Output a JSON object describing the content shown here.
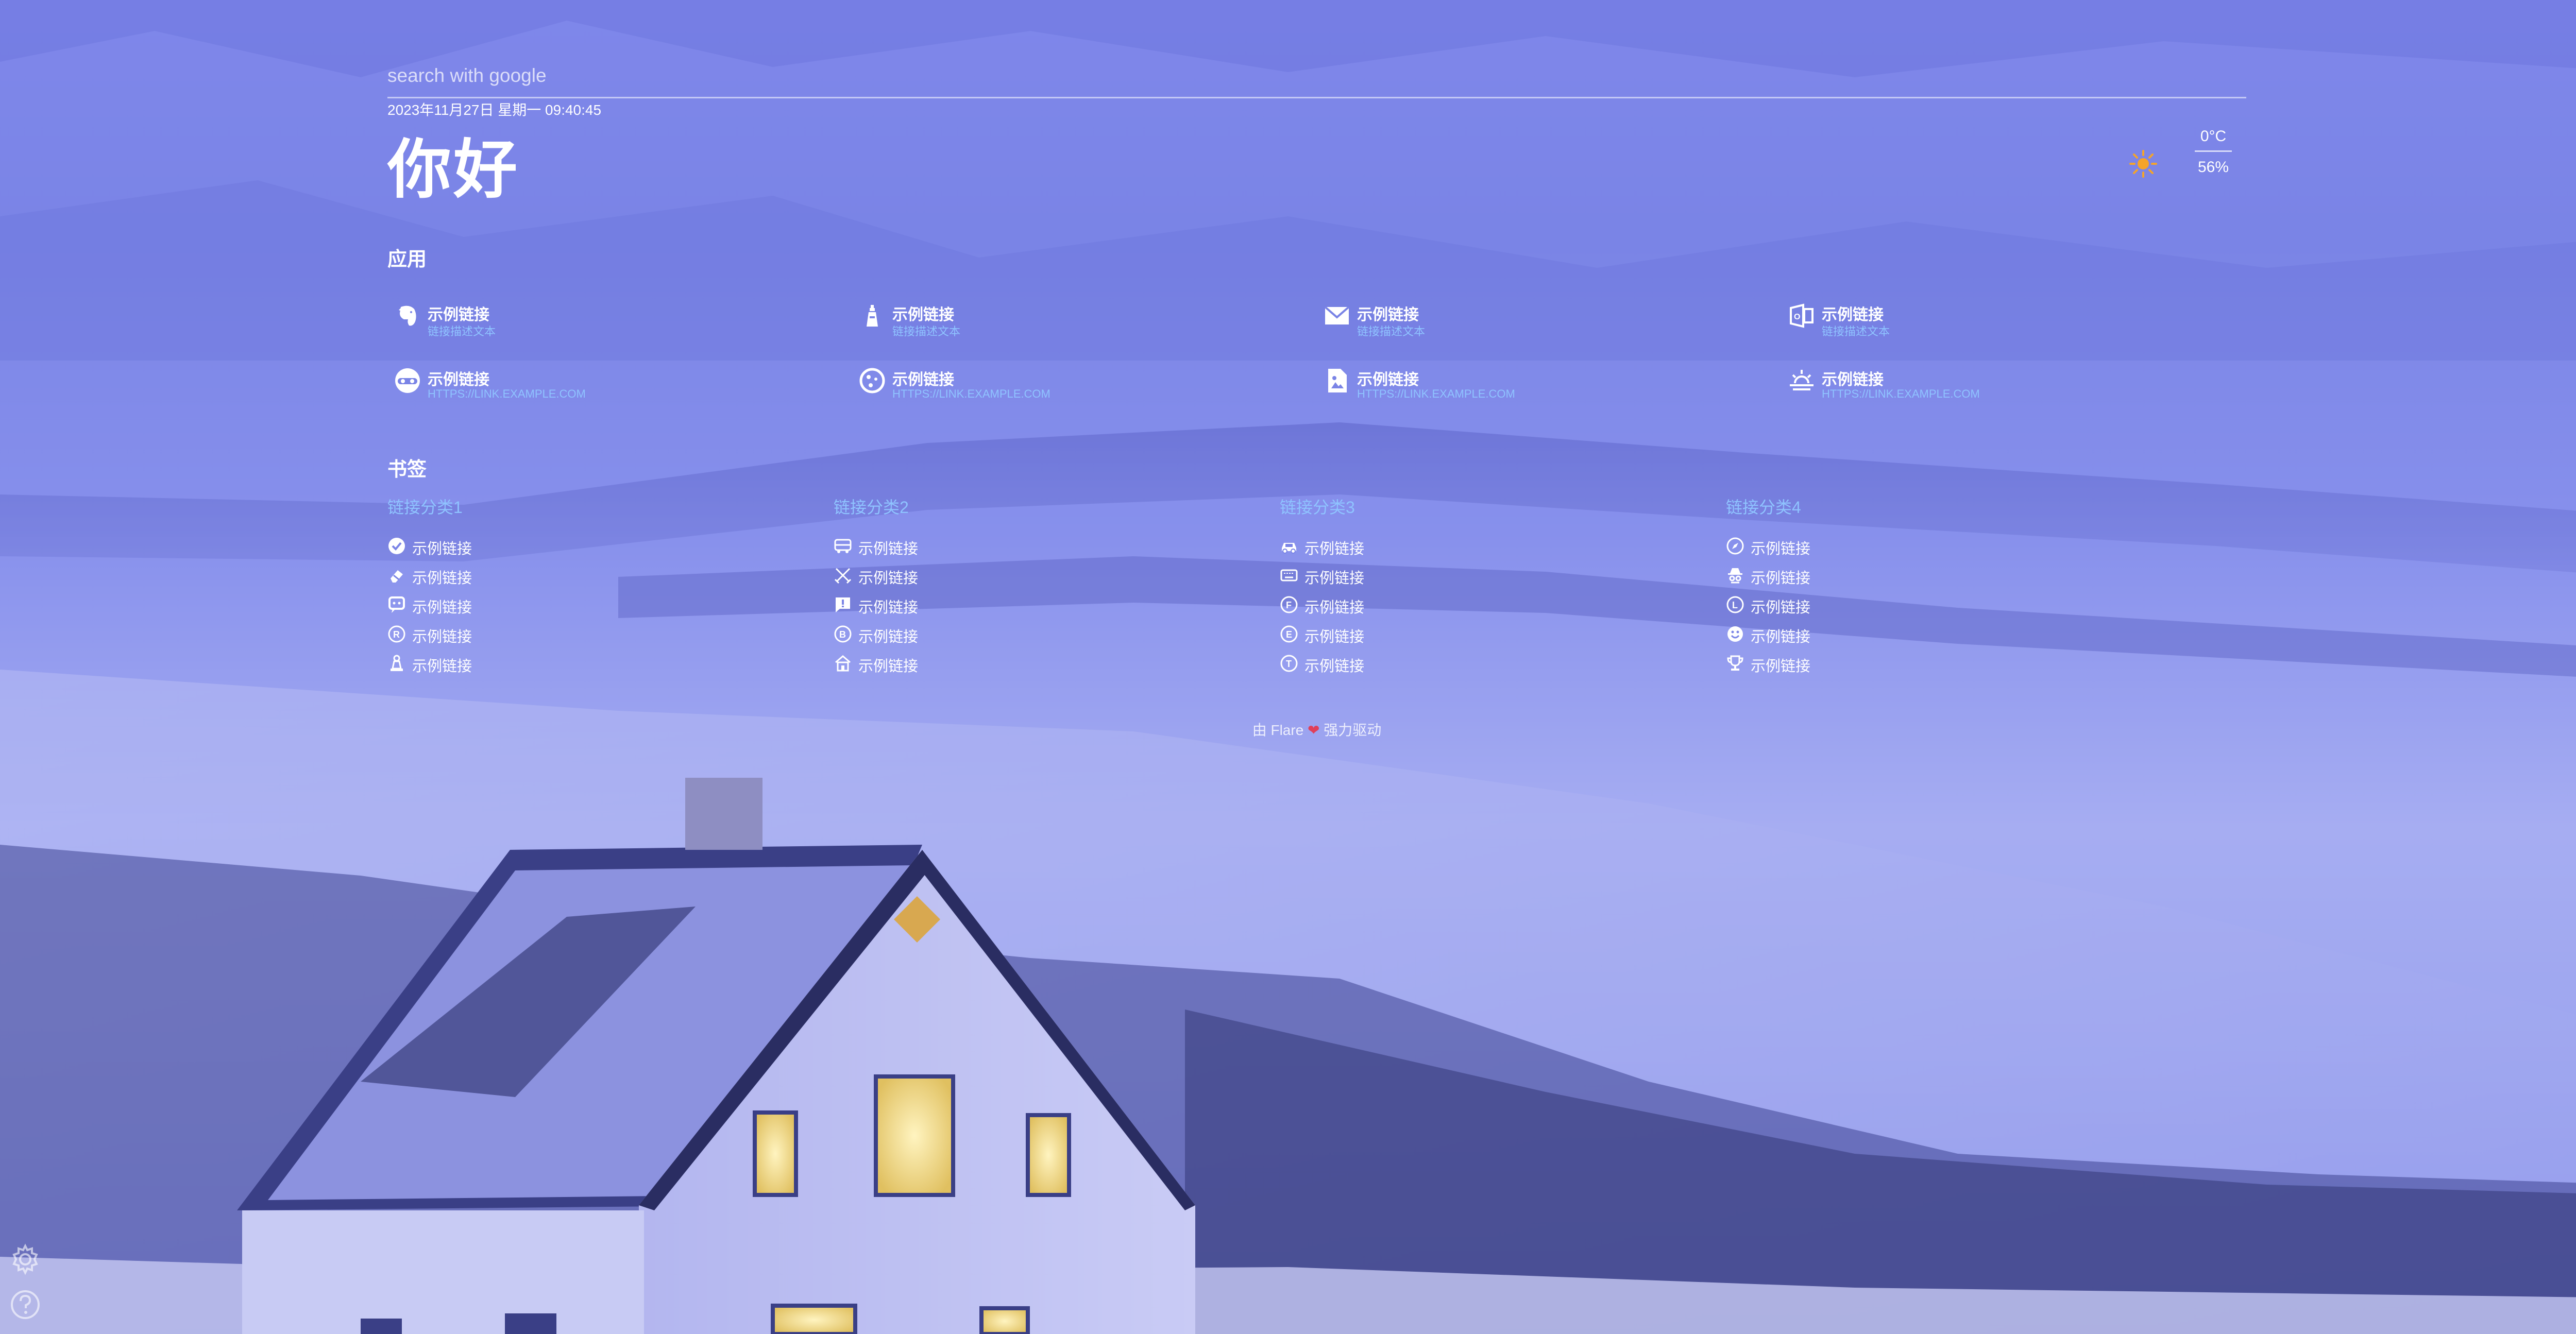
{
  "search": {
    "placeholder": "search with google"
  },
  "datetime": "2023年11月27日 星期一 09:40:45",
  "greeting": "你好",
  "weather": {
    "icon": "sun-icon",
    "temperature": "0°C",
    "humidity": "56%"
  },
  "apps": {
    "title": "应用",
    "items": [
      {
        "title": "示例链接",
        "desc": "链接描述文本",
        "icon": "evernote-icon"
      },
      {
        "title": "示例链接",
        "desc": "链接描述文本",
        "icon": "lighthouse-icon"
      },
      {
        "title": "示例链接",
        "desc": "链接描述文本",
        "icon": "mail-icon"
      },
      {
        "title": "示例链接",
        "desc": "链接描述文本",
        "icon": "office-icon"
      },
      {
        "title": "示例链接",
        "desc": "HTTPS://LINK.EXAMPLE.COM",
        "icon": "incognito-icon"
      },
      {
        "title": "示例链接",
        "desc": "HTTPS://LINK.EXAMPLE.COM",
        "icon": "cookie-icon"
      },
      {
        "title": "示例链接",
        "desc": "HTTPS://LINK.EXAMPLE.COM",
        "icon": "image-file-icon"
      },
      {
        "title": "示例链接",
        "desc": "HTTPS://LINK.EXAMPLE.COM",
        "icon": "sunrise-icon"
      }
    ]
  },
  "bookmarks": {
    "title": "书签",
    "categories": [
      {
        "name": "链接分类1",
        "items": [
          {
            "label": "示例链接",
            "icon": "check-circle-icon"
          },
          {
            "label": "示例链接",
            "icon": "eraser-icon"
          },
          {
            "label": "示例链接",
            "icon": "chat-bubble-icon"
          },
          {
            "label": "示例链接",
            "icon": "circle-r-icon"
          },
          {
            "label": "示例链接",
            "icon": "chess-pawn-icon"
          }
        ]
      },
      {
        "name": "链接分类2",
        "items": [
          {
            "label": "示例链接",
            "icon": "bus-icon"
          },
          {
            "label": "示例链接",
            "icon": "swords-icon"
          },
          {
            "label": "示例链接",
            "icon": "message-alert-icon"
          },
          {
            "label": "示例链接",
            "icon": "circle-b-icon"
          },
          {
            "label": "示例链接",
            "icon": "house-icon"
          }
        ]
      },
      {
        "name": "链接分类3",
        "items": [
          {
            "label": "示例链接",
            "icon": "car-icon"
          },
          {
            "label": "示例链接",
            "icon": "keyboard-icon"
          },
          {
            "label": "示例链接",
            "icon": "circle-f-icon"
          },
          {
            "label": "示例链接",
            "icon": "circle-e-icon"
          },
          {
            "label": "示例链接",
            "icon": "circle-t-icon"
          }
        ]
      },
      {
        "name": "链接分类4",
        "items": [
          {
            "label": "示例链接",
            "icon": "compass-icon"
          },
          {
            "label": "示例链接",
            "icon": "detective-icon"
          },
          {
            "label": "示例链接",
            "icon": "circle-l-icon"
          },
          {
            "label": "示例链接",
            "icon": "emoji-happy-icon"
          },
          {
            "label": "示例链接",
            "icon": "trophy-icon"
          }
        ]
      }
    ]
  },
  "footer": {
    "prefix": "由 Flare",
    "heart": "❤",
    "suffix": "强力驱动"
  },
  "floating": {
    "settings_icon": "gear-icon",
    "help_icon": "question-icon"
  }
}
